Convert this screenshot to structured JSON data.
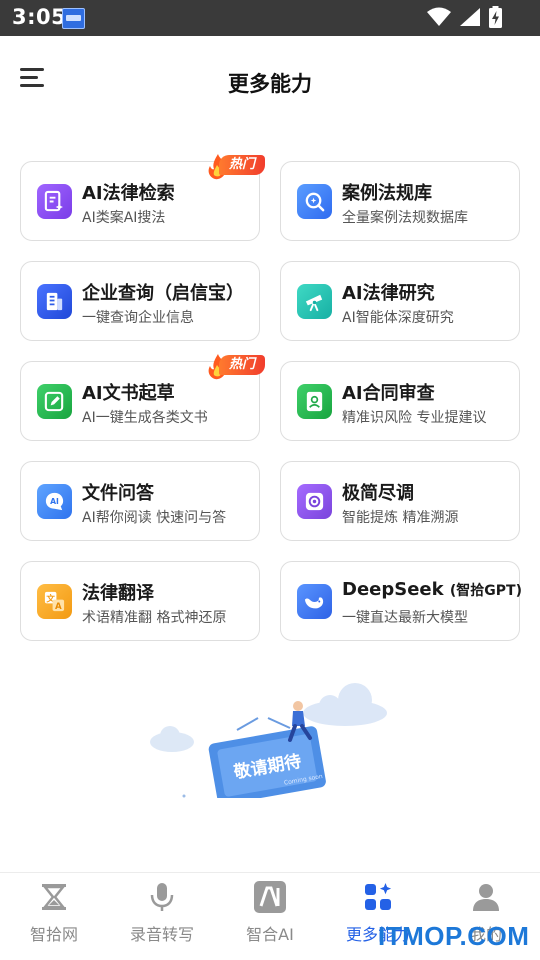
{
  "status": {
    "time": "3:05"
  },
  "header": {
    "title": "更多能力"
  },
  "cards": [
    {
      "title": "AI法律检索",
      "subtitle": "AI类案AI搜法",
      "icon": "search-document-icon",
      "color": "#8a4cf0",
      "hot": true
    },
    {
      "title": "案例法规库",
      "subtitle": "全量案例法规数据库",
      "icon": "magnify-icon",
      "color": "#3b7ff5"
    },
    {
      "title": "企业查询（启信宝）",
      "subtitle": "一键查询企业信息",
      "icon": "building-icon",
      "color": "#2e5de8"
    },
    {
      "title": "AI法律研究",
      "subtitle": "AI智能体深度研究",
      "icon": "telescope-icon",
      "color": "#1fbfb0"
    },
    {
      "title": "AI文书起草",
      "subtitle": "AI一键生成各类文书",
      "icon": "pen-document-icon",
      "color": "#22b24c",
      "hot": true
    },
    {
      "title": "AI合同审查",
      "subtitle": "精准识风险 专业提建议",
      "icon": "contract-icon",
      "color": "#26b34f"
    },
    {
      "title": "文件问答",
      "subtitle": "AI帮你阅读 快速问与答",
      "icon": "chat-ai-icon",
      "color": "#3c86f4"
    },
    {
      "title": "极简尽调",
      "subtitle": "智能提炼 精准溯源",
      "icon": "target-icon",
      "color": "#8a52e6"
    },
    {
      "title": "法律翻译",
      "subtitle": "术语精准翻 格式神还原",
      "icon": "translate-icon",
      "color": "#f5a623"
    },
    {
      "title": "DeepSeek",
      "title_suffix": "(智拾GPT)",
      "subtitle": "一键直达最新大模型",
      "icon": "whale-icon",
      "color": "#3d7af0"
    }
  ],
  "hot_label": "热门",
  "illustration": {
    "sign_text": "敬请期待",
    "small_text": "Coming soon"
  },
  "tabs": [
    {
      "label": "智拾网",
      "icon": "hourglass-icon",
      "active": false
    },
    {
      "label": "录音转写",
      "icon": "microphone-icon",
      "active": false
    },
    {
      "label": "智合AI",
      "icon": "ai-logo-icon",
      "active": false
    },
    {
      "label": "更多能力",
      "icon": "apps-grid-icon",
      "active": true
    },
    {
      "label": "我的",
      "icon": "profile-icon",
      "active": false
    }
  ],
  "watermark": "ITMOP.COM",
  "colors": {
    "accent": "#2461e6",
    "hot": "#f13d2d",
    "status_bar": "#3a3a3a"
  }
}
